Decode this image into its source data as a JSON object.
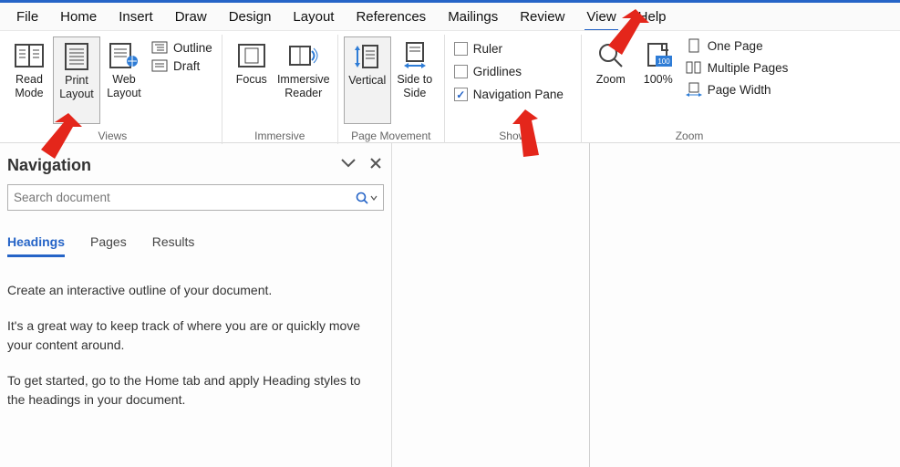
{
  "menubar": [
    "File",
    "Home",
    "Insert",
    "Draw",
    "Design",
    "Layout",
    "References",
    "Mailings",
    "Review",
    "View",
    "Help"
  ],
  "active_menu": "View",
  "ribbon": {
    "views": {
      "label": "Views",
      "read_mode": "Read Mode",
      "print_layout": "Print Layout",
      "web_layout": "Web Layout",
      "outline": "Outline",
      "draft": "Draft"
    },
    "immersive": {
      "label": "Immersive",
      "focus": "Focus",
      "immersive_reader": "Immersive Reader"
    },
    "page_movement": {
      "label": "Page Movement",
      "vertical": "Vertical",
      "side": "Side to Side"
    },
    "show": {
      "label": "Show",
      "ruler": "Ruler",
      "gridlines": "Gridlines",
      "nav_pane": "Navigation Pane",
      "ruler_checked": false,
      "gridlines_checked": false,
      "nav_pane_checked": true
    },
    "zoom": {
      "label": "Zoom",
      "zoom": "Zoom",
      "hundred": "100%",
      "one_page": "One Page",
      "multiple_pages": "Multiple Pages",
      "page_width": "Page Width"
    }
  },
  "nav": {
    "title": "Navigation",
    "search_placeholder": "Search document",
    "tabs": {
      "headings": "Headings",
      "pages": "Pages",
      "results": "Results"
    },
    "body": {
      "p1": "Create an interactive outline of your document.",
      "p2": "It's a great way to keep track of where you are or quickly move your content around.",
      "p3": "To get started, go to the Home tab and apply Heading styles to the headings in your document."
    }
  },
  "colors": {
    "accent": "#2564c7"
  }
}
